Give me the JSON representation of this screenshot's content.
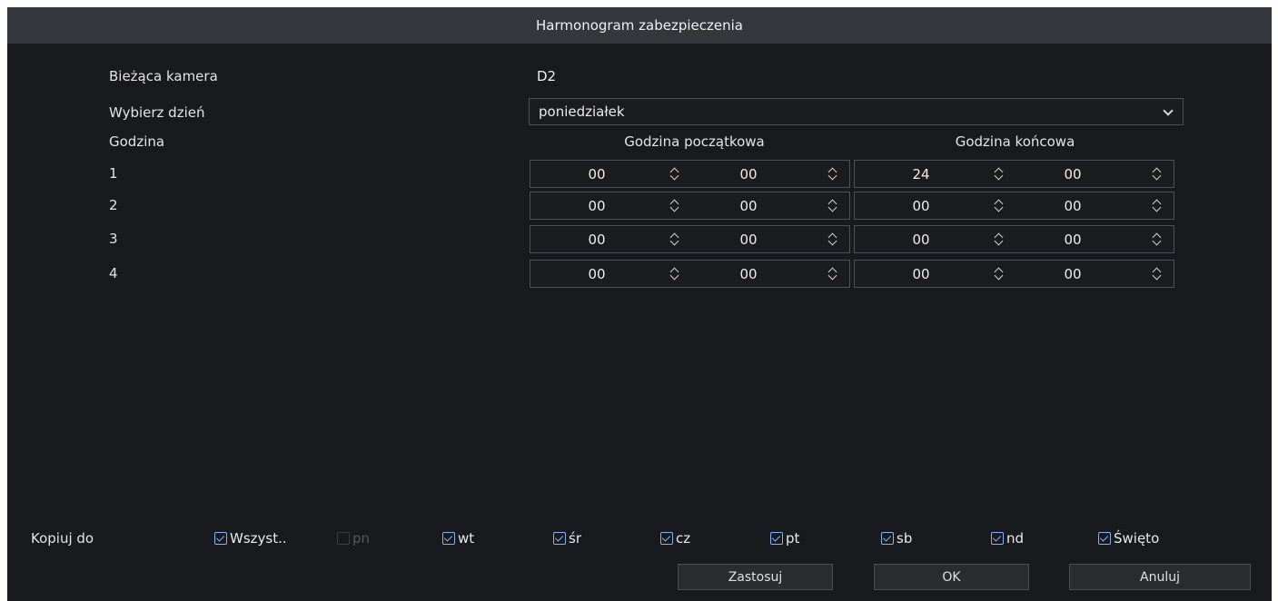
{
  "dialog": {
    "title": "Harmonogram zabezpieczenia"
  },
  "fields": {
    "camera_label": "Bieżąca kamera",
    "camera_value": "D2",
    "day_label": "Wybierz dzień",
    "day_value": "poniedziałek",
    "hour_label": "Godzina"
  },
  "columns": {
    "start": "Godzina początkowa",
    "end": "Godzina końcowa"
  },
  "rows": [
    {
      "label": "1",
      "start_h": "00",
      "start_m": "00",
      "end_h": "24",
      "end_m": "00"
    },
    {
      "label": "2",
      "start_h": "00",
      "start_m": "00",
      "end_h": "00",
      "end_m": "00"
    },
    {
      "label": "3",
      "start_h": "00",
      "start_m": "00",
      "end_h": "00",
      "end_m": "00"
    },
    {
      "label": "4",
      "start_h": "00",
      "start_m": "00",
      "end_h": "00",
      "end_m": "00"
    }
  ],
  "copy": {
    "label": "Kopiuj do",
    "options": [
      {
        "label": "Wszyst..",
        "checked": true,
        "enabled": true
      },
      {
        "label": "pn",
        "checked": false,
        "enabled": false
      },
      {
        "label": "wt",
        "checked": true,
        "enabled": true
      },
      {
        "label": "śr",
        "checked": true,
        "enabled": true
      },
      {
        "label": "cz",
        "checked": true,
        "enabled": true
      },
      {
        "label": "pt",
        "checked": true,
        "enabled": true
      },
      {
        "label": "sb",
        "checked": true,
        "enabled": true
      },
      {
        "label": "nd",
        "checked": true,
        "enabled": true
      },
      {
        "label": "Święto",
        "checked": true,
        "enabled": true
      }
    ]
  },
  "buttons": {
    "apply": "Zastosuj",
    "ok": "OK",
    "cancel": "Anuluj"
  },
  "colors": {
    "background": "#191a1d",
    "titlebar": "#34373c",
    "checkbox_accent": "#7fb2ff"
  }
}
